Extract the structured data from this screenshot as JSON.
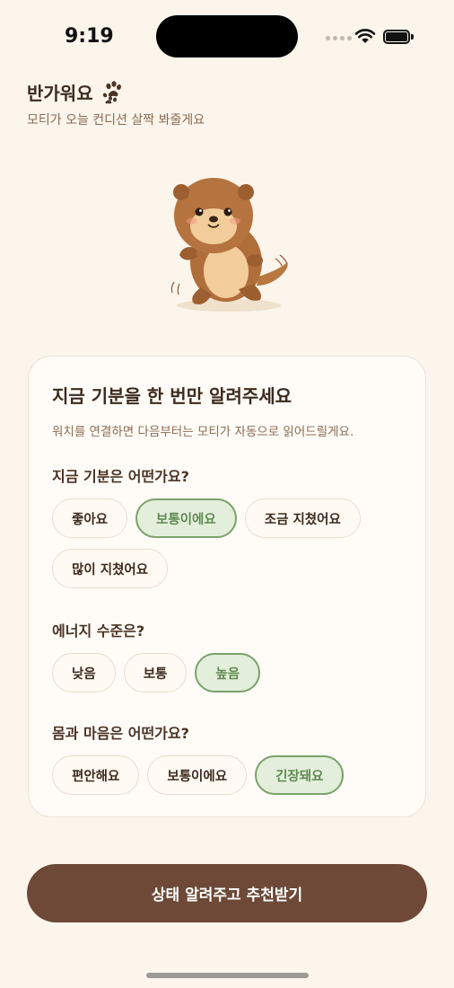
{
  "status_bar": {
    "time": "9:19",
    "icons": [
      "signal-icon",
      "wifi-icon",
      "battery-icon"
    ]
  },
  "header": {
    "greeting": "반가워요",
    "greeting_icon": "paw-icon",
    "subtitle": "모티가 오늘 컨디션 살짝 봐줄게요"
  },
  "mascot": {
    "name": "otter-mascot"
  },
  "card": {
    "title": "지금 기분을 한 번만 알려주세요",
    "description": "워치를 연결하면 다음부터는 모티가 자동으로 읽어드릴게요.",
    "questions": [
      {
        "label": "지금 기분은 어떤가요?",
        "options": [
          "좋아요",
          "보통이에요",
          "조금 지쳤어요",
          "많이 지쳤어요"
        ],
        "selected": "보통이에요"
      },
      {
        "label": "에너지 수준은?",
        "options": [
          "낮음",
          "보통",
          "높음"
        ],
        "selected": "높음"
      },
      {
        "label": "몸과 마음은 어떤가요?",
        "options": [
          "편안해요",
          "보통이에요",
          "긴장돼요"
        ],
        "selected": "긴장돼요"
      }
    ]
  },
  "cta": {
    "label": "상태 알려주고 추천받기"
  },
  "colors": {
    "background": "#fbf5ec",
    "primary_brown": "#6e4938",
    "selected_green": "#7ba16c",
    "selected_bg": "#e3eedb",
    "muted_text": "#8b6b55"
  }
}
